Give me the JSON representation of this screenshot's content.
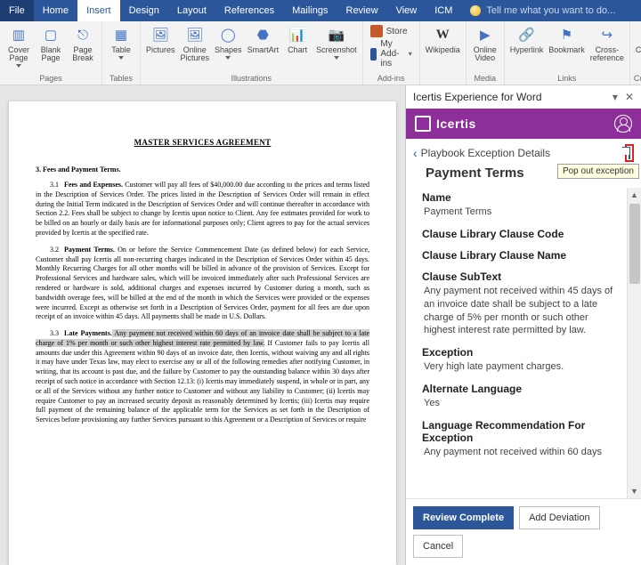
{
  "menu": {
    "file": "File",
    "home": "Home",
    "insert": "Insert",
    "design": "Design",
    "layout": "Layout",
    "references": "References",
    "mailings": "Mailings",
    "review": "Review",
    "view": "View",
    "icm": "ICM"
  },
  "tellme_placeholder": "Tell me what you want to do...",
  "ribbon": {
    "pages": {
      "label": "Pages",
      "coverPage": "Cover\nPage",
      "blankPage": "Blank\nPage",
      "pageBreak": "Page\nBreak"
    },
    "tables": {
      "label": "Tables",
      "table": "Table"
    },
    "illustrations": {
      "label": "Illustrations",
      "pictures": "Pictures",
      "onlinePictures": "Online\nPictures",
      "shapes": "Shapes",
      "smartart": "SmartArt",
      "chart": "Chart",
      "screenshot": "Screenshot"
    },
    "addins": {
      "label": "Add-ins",
      "store": "Store",
      "myAddins": "My Add-ins"
    },
    "wiki": "Wikipedia",
    "media": {
      "label": "Media",
      "onlineVideo": "Online\nVideo"
    },
    "links": {
      "label": "Links",
      "hyperlink": "Hyperlink",
      "bookmark": "Bookmark",
      "crossRef": "Cross-\nreference"
    },
    "comments": {
      "label": "Comments",
      "comment": "Comment"
    }
  },
  "document": {
    "title": "MASTER SERVICES AGREEMENT",
    "sec3": "3.   Fees and Payment Terms.",
    "p31_num": "3.1",
    "p31_title": "Fees and Expenses.",
    "p31_body": " Customer will pay all fees of $40,000.00 due according to the prices and terms listed in the Description of Services Order. The prices listed in the Description of Services Order will remain in effect during the Initial Term indicated in the Description of Services Order and will continue thereafter in accordance with Section 2.2. Fees shall be subject to change by Icertis upon notice to Client. Any fee estimates provided for work to be billed on an hourly or daily basis are for informational purposes only; Client agrees to pay for the actual services provided by Icertis at the specified rate.",
    "p32_num": "3.2",
    "p32_title": "Payment Terms.",
    "p32_body": " On or before the Service Commencement Date (as defined below) for each Service, Customer shall pay Icertis all non-recurring charges indicated in the Description of Services Order within 45 days. Monthly Recurring Charges for all other months will be billed in advance of the provision of Services. Except for Professional Services and hardware sales, which will be invoiced immediately after such Professional Services are rendered or hardware is sold, additional charges and expenses incurred by Customer during a month, such as bandwidth overage fees, will be billed at the end of the month in which the Services were provided or the expenses were incurred. Except as otherwise set forth in a Description of Services Order, payment for all fees are due upon receipt of an invoice within 45 days. All payments shall be made in U.S. Dollars.",
    "p33_num": "3.3",
    "p33_title": "Late Payments.",
    "p33_hl": " Any payment not received within 60 days of an invoice date shall be subject to a late charge of 1% per month or such other highest interest rate permitted by law.",
    "p33_body": " If Customer fails to pay Icertis all amounts due under this Agreement within 90 days of an invoice date, then Icertis, without waiving any and all rights it may have under Texas law, may elect to exercise any or all of the following remedies after notifying Customer, in writing, that its account is past due, and the failure by Customer to pay the outstanding balance within 30 days after receipt of such notice in accordance with Section 12.13: (i) Icertis may immediately suspend, in whole or in part, any or all of the Services without any further notice to Customer and without any liability to Customer; (ii) Icertis may require Customer to pay an increased security deposit as reasonably determined by Icertis; (iii) Icertis may require full payment of the remaining balance of the applicable term for the Services as set forth in the Description of Services before provisioning any further Services pursuant to this Agreement or a Description of Services or require"
  },
  "panel": {
    "title": "Icertis Experience for Word",
    "brand": "Icertis",
    "back": "Playbook Exception Details",
    "tooltip": "Pop out exception",
    "section": "Payment Terms",
    "name_label": "Name",
    "name_value": "Payment Terms",
    "clcc_label": "Clause Library Clause Code",
    "clcn_label": "Clause Library Clause Name",
    "subtext_label": "Clause SubText",
    "subtext_value": "Any payment not received within 45 days of an invoice date shall be subject to a late charge of 5% per month or such other highest interest rate permitted by law.",
    "exception_label": "Exception",
    "exception_value": "Very high late payment charges.",
    "altlang_label": "Alternate Language",
    "altlang_value": "Yes",
    "langrec_label": "Language Recommendation For Exception",
    "langrec_value": "Any payment not received within 60 days",
    "btn_review": "Review Complete",
    "btn_deviation": "Add Deviation",
    "btn_cancel": "Cancel"
  },
  "colors": {
    "ribbonBlue": "#2b579a",
    "brandPurple": "#8e2e9b"
  }
}
